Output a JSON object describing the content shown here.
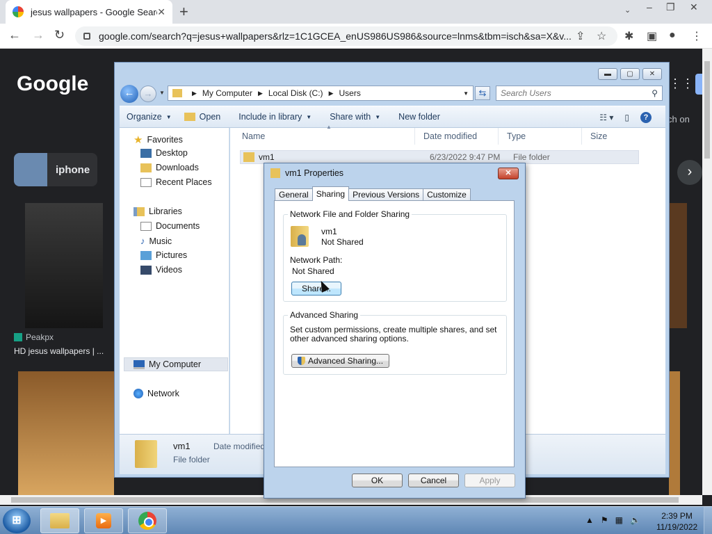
{
  "browser": {
    "tab_title": "jesus wallpapers - Google Search",
    "tab_close": "✕",
    "new_tab": "+",
    "url": "google.com/search?q=jesus+wallpapers&rlz=1C1GCEA_enUS986US986&source=lnms&tbm=isch&sa=X&v..."
  },
  "google": {
    "logo": "Google",
    "chip_label": "iphone",
    "image1_source": "Peakpx",
    "image1_title": "HD jesus wallpapers | ...",
    "peek_text": "ch on"
  },
  "explorer": {
    "breadcrumb": [
      "My Computer",
      "Local Disk (C:)",
      "Users"
    ],
    "search_placeholder": "Search Users",
    "commands": {
      "organize": "Organize",
      "open": "Open",
      "include_in_library": "Include in library",
      "share_with": "Share with",
      "new_folder": "New folder"
    },
    "nav": {
      "favorites": "Favorites",
      "desktop": "Desktop",
      "downloads": "Downloads",
      "recent_places": "Recent Places",
      "libraries": "Libraries",
      "documents": "Documents",
      "music": "Music",
      "pictures": "Pictures",
      "videos": "Videos",
      "my_computer": "My Computer",
      "network": "Network"
    },
    "columns": [
      "Name",
      "Date modified",
      "Type",
      "Size"
    ],
    "rows": [
      {
        "name": "vm1",
        "date": "6/23/2022 9:47 PM",
        "type": "File folder"
      }
    ],
    "details": {
      "name": "vm1",
      "type": "File folder",
      "date_label": "Date modified"
    }
  },
  "dialog": {
    "title": "vm1 Properties",
    "close": "✕",
    "tabs": [
      "General",
      "Sharing",
      "Previous Versions",
      "Customize"
    ],
    "network_group": {
      "title": "Network File and Folder Sharing",
      "folder_name": "vm1",
      "folder_status": "Not Shared",
      "path_label": "Network Path:",
      "path_value": "Not Shared",
      "share_button": "Share..."
    },
    "advanced_group": {
      "title": "Advanced Sharing",
      "description": "Set custom permissions, create multiple shares, and set other advanced sharing options.",
      "button": "Advanced Sharing..."
    },
    "buttons": {
      "ok": "OK",
      "cancel": "Cancel",
      "apply": "Apply"
    }
  },
  "taskbar": {
    "time": "2:39 PM",
    "date": "11/19/2022"
  }
}
